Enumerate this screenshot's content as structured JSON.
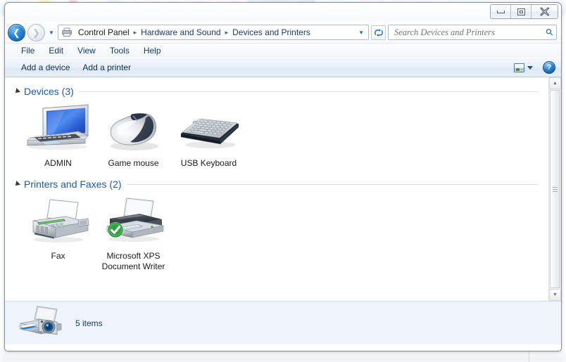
{
  "window": {
    "controls": {
      "minimize_label": "Minimize",
      "maximize_label": "Maximize",
      "close_label": "Close"
    }
  },
  "addressbar": {
    "back_label": "Back",
    "forward_label": "Forward",
    "history_label": "Recent pages",
    "location_icon": "printer-icon",
    "breadcrumbs": [
      "Control Panel",
      "Hardware and Sound",
      "Devices and Printers"
    ],
    "separator": "▸",
    "dropdown_caret": "▼",
    "refresh_label": "↻",
    "refresh_icon": "refresh-icon"
  },
  "search": {
    "placeholder": "Search Devices and Printers",
    "value": "",
    "icon": "search-icon"
  },
  "menubar": {
    "items": [
      {
        "label": "File"
      },
      {
        "label": "Edit"
      },
      {
        "label": "View"
      },
      {
        "label": "Tools"
      },
      {
        "label": "Help"
      }
    ]
  },
  "toolbar": {
    "add_device_label": "Add a device",
    "add_printer_label": "Add a printer",
    "view_icon": "change-view-icon",
    "view_caret": "▼",
    "help_label": "?",
    "help_icon": "help-icon"
  },
  "groups": [
    {
      "title": "Devices (3)",
      "collapse_icon": "triangle-down-icon",
      "items": [
        {
          "label": "ADMIN",
          "icon": "laptop-icon",
          "default": false
        },
        {
          "label": "Game mouse",
          "icon": "mouse-icon",
          "default": false
        },
        {
          "label": "USB Keyboard",
          "icon": "keyboard-icon",
          "default": false
        }
      ]
    },
    {
      "title": "Printers and Faxes (2)",
      "collapse_icon": "triangle-down-icon",
      "items": [
        {
          "label": "Fax",
          "icon": "fax-icon",
          "default": false
        },
        {
          "label": "Microsoft XPS\nDocument Writer",
          "icon": "printer-icon",
          "default": true
        }
      ]
    }
  ],
  "scrollbar": {
    "up_label": "▲",
    "down_label": "▼"
  },
  "statusbar": {
    "text": "5 items",
    "icon": "scanner-camera-icon"
  },
  "colors": {
    "accent_blue": "#1f5aa0",
    "toolbar_blue": "#e7eff8",
    "status_bg": "#eff3fa",
    "default_check_green": "#2fa342",
    "link_text": "#14385f"
  }
}
